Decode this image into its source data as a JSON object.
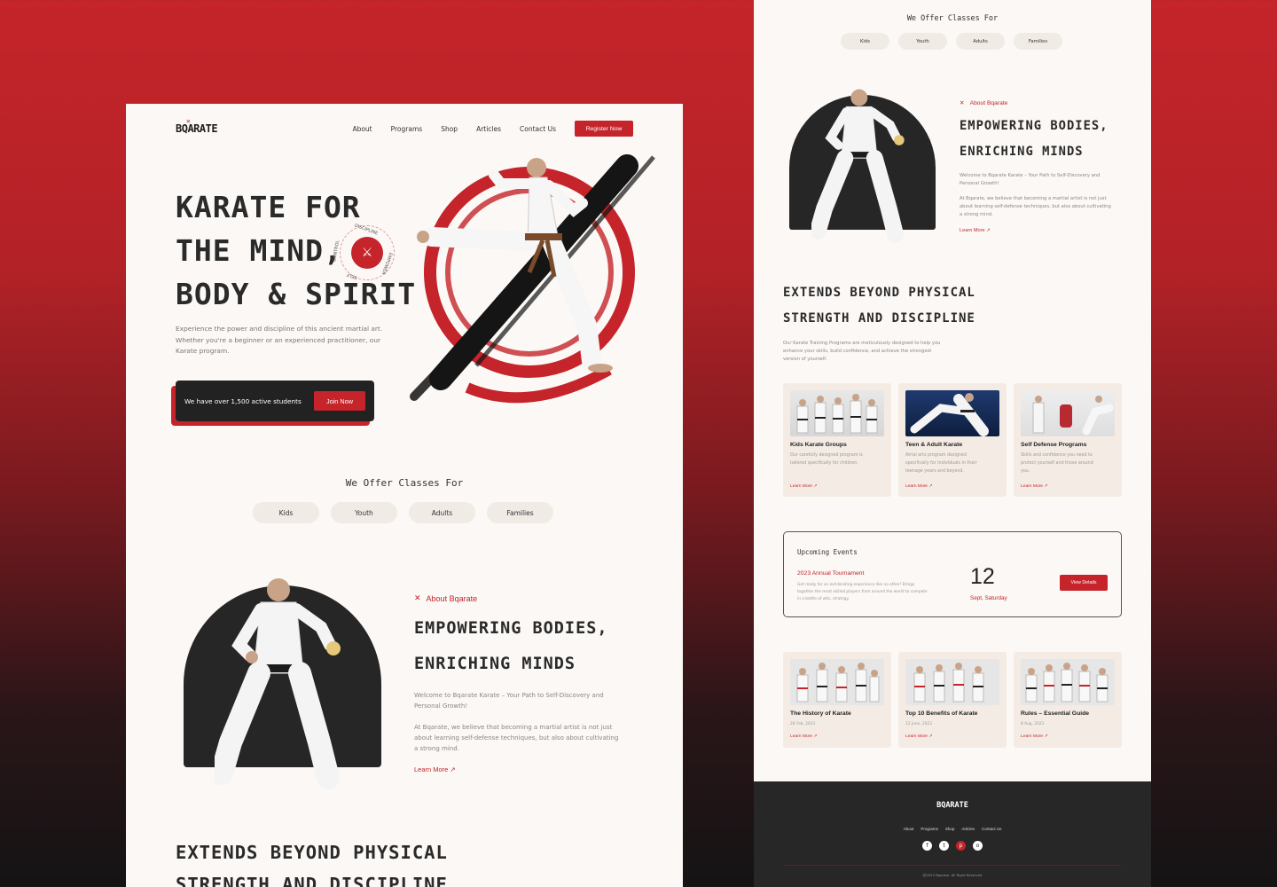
{
  "left": {
    "logo": "BQARATE",
    "nav": [
      "About",
      "Programs",
      "Shop",
      "Articles",
      "Contact Us"
    ],
    "register": "Register Now",
    "hero": {
      "line1": "KARATE FOR",
      "line2": "THE MIND,",
      "line3": "BODY & SPIRIT",
      "desc": "Experience the power and discipline of this ancient martial art. Whether you're a beginner or an experienced practitioner, our Karate program.",
      "students": "We have over 1,500 active students",
      "join": "Join Now",
      "badge_top": "DISCIPLINE",
      "badge_left": "CONTROL",
      "badge_bottom": "SELF",
      "badge_right": "EMPOWER"
    },
    "offer_title": "We Offer Classes For",
    "pills": [
      "Kids",
      "Youth",
      "Adults",
      "Families"
    ],
    "about": {
      "tag": "About Bqarate",
      "h1": "EMPOWERING BODIES,",
      "h2": "ENRICHING MINDS",
      "p1": "Welcome to Bqarate Karate – Your Path to Self-Discovery and Personal Growth!",
      "p2": "At Bqarate, we believe that becoming a martial artist is not just about learning self-defense techniques, but also about cultivating a strong mind.",
      "learn": "Learn More ↗"
    },
    "extends_h1": "EXTENDS BEYOND PHYSICAL",
    "extends_h2": "STRENGTH AND DISCIPLINE"
  },
  "right": {
    "offer_title": "We Offer Classes For",
    "pills": [
      "Kids",
      "Youth",
      "Adults",
      "Families"
    ],
    "about": {
      "tag": "About Bqarate",
      "h1": "EMPOWERING BODIES,",
      "h2": "ENRICHING MINDS",
      "p1": "Welcome to Bqarate Karate – Your Path to Self-Discovery and Personal Growth!",
      "p2": "At Bqarate, we believe that becoming a martial artist is not just about learning self-defense techniques, but also about cultivating a strong mind.",
      "learn": "Learn More ↗"
    },
    "extends_h1": "EXTENDS BEYOND PHYSICAL",
    "extends_h2": "STRENGTH AND DISCIPLINE",
    "extends_p": "Our Karate Training Programs are meticulously designed to help you enhance your skills, build confidence, and achieve the strongest version of yourself.",
    "programs": [
      {
        "title": "Kids Karate Groups",
        "desc": "Our carefully designed program is tailored specifically for children.",
        "link": "Learn More ↗"
      },
      {
        "title": "Teen & Adult Karate",
        "desc": "Atrial arts program designed specifically for individuals in their teenage years and beyond.",
        "link": "Learn More ↗"
      },
      {
        "title": "Self Defense Programs",
        "desc": "Skills and confidence you need to protect yourself and those around you.",
        "link": "Learn More ↗"
      }
    ],
    "events": {
      "title": "Upcoming Events",
      "name": "2023 Annual Tournament",
      "desc": "Get ready for an exhilarating experience like no other! Brings together the most skilled players from around the world to compete in a battle of wits, strategy.",
      "day": "12",
      "date": "Sept, Saturday",
      "button": "View Details"
    },
    "articles": [
      {
        "title": "The History of Karate",
        "date": "28 Feb, 2023",
        "link": "Learn More ↗"
      },
      {
        "title": "Top 10 Benefits of  Karate",
        "date": "12 June, 2023",
        "link": "Learn More ↗"
      },
      {
        "title": "Rules – Essential Guide",
        "date": "8 Aug, 2023",
        "link": "Learn More ↗"
      }
    ],
    "footer": {
      "logo": "BQARATE",
      "nav": [
        "About",
        "Programs",
        "Shop",
        "Articles",
        "Contact Us"
      ],
      "social": [
        "f",
        "t",
        "p",
        "o"
      ],
      "copyright": "@2023 Bqarate. All Right Reserved"
    }
  },
  "colors": {
    "accent": "#c4242a",
    "dark": "#272727",
    "page": "#fbf8f5",
    "card": "#f4ece4"
  }
}
